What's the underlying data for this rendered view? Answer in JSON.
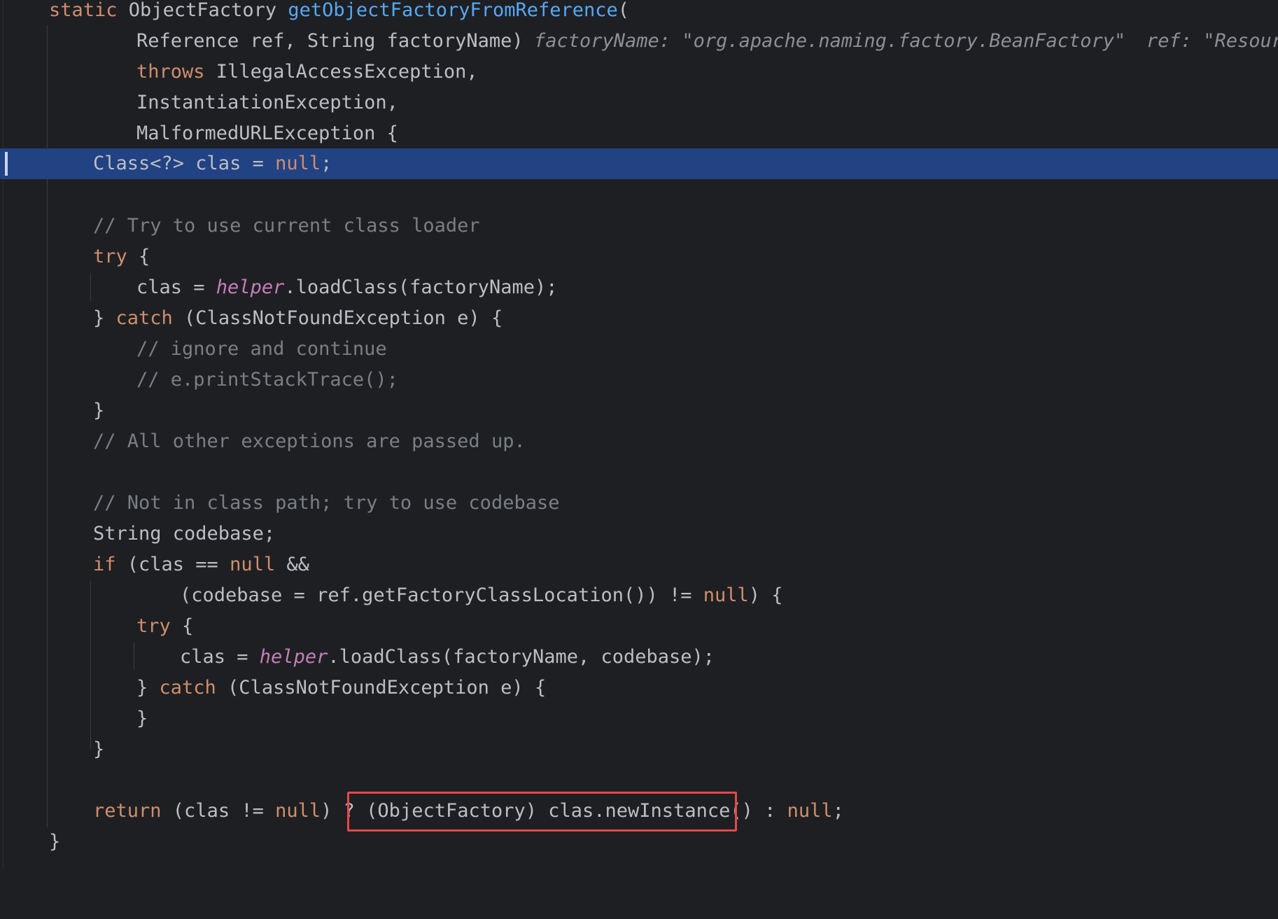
{
  "editor": {
    "lines": {
      "l1": {
        "kw_static": "static",
        "type": " ObjectFactory ",
        "method": "getObjectFactoryFromReference",
        "paren": "("
      },
      "l2": {
        "params": "Reference ref, String factoryName)",
        "hint_factory": "factoryName: \"org.apache.naming.factory.BeanFactory\"",
        "hint_ref": "ref: \"Resour"
      },
      "l3": {
        "kw_throws": "throws",
        "rest": " IllegalAccessException,"
      },
      "l4": {
        "text": "InstantiationException,"
      },
      "l5": {
        "text": "MalformedURLException {"
      },
      "l6": {
        "pre": "Class<?> clas = ",
        "kw_null": "null",
        "post": ";"
      },
      "l8": {
        "comment": "// Try to use current class loader"
      },
      "l9": {
        "kw_try": "try",
        "rest": " {"
      },
      "l10": {
        "pre": "clas = ",
        "field": "helper",
        "post": ".loadClass(factoryName);"
      },
      "l11": {
        "pre": "} ",
        "kw_catch": "catch",
        "post": " (ClassNotFoundException e) {"
      },
      "l12": {
        "comment": "// ignore and continue"
      },
      "l13": {
        "comment": "// e.printStackTrace();"
      },
      "l14": {
        "text": "}"
      },
      "l15": {
        "comment": "// All other exceptions are passed up."
      },
      "l17": {
        "comment": "// Not in class path; try to use codebase"
      },
      "l18": {
        "text": "String codebase;"
      },
      "l19": {
        "kw_if": "if",
        "pre": " (clas == ",
        "kw_null": "null",
        "post": " &&"
      },
      "l20": {
        "pre": "(codebase = ref.getFactoryClassLocation()) != ",
        "kw_null": "null",
        "post": ") {"
      },
      "l21": {
        "kw_try": "try",
        "rest": " {"
      },
      "l22": {
        "pre": "clas = ",
        "field": "helper",
        "post": ".loadClass(factoryName, codebase);"
      },
      "l23": {
        "pre": "} ",
        "kw_catch": "catch",
        "post": " (ClassNotFoundException e) {"
      },
      "l24": {
        "text": "}"
      },
      "l25": {
        "text": "}"
      },
      "l27": {
        "kw_return": "return",
        "pre": " (clas != ",
        "kw_null": "null",
        "mid": ") ? ",
        "boxed": "(ObjectFactory) clas.newInstance()",
        "post1": " : ",
        "kw_null2": "null",
        "post2": ";"
      },
      "l28": {
        "text": "}"
      }
    }
  },
  "colors": {
    "background": "#1e1f22",
    "current_line": "#214283",
    "keyword": "#cf8e6d",
    "method": "#56a8f5",
    "field": "#c77dbb",
    "comment": "#7a7e85",
    "highlight_box": "#e5484d"
  }
}
